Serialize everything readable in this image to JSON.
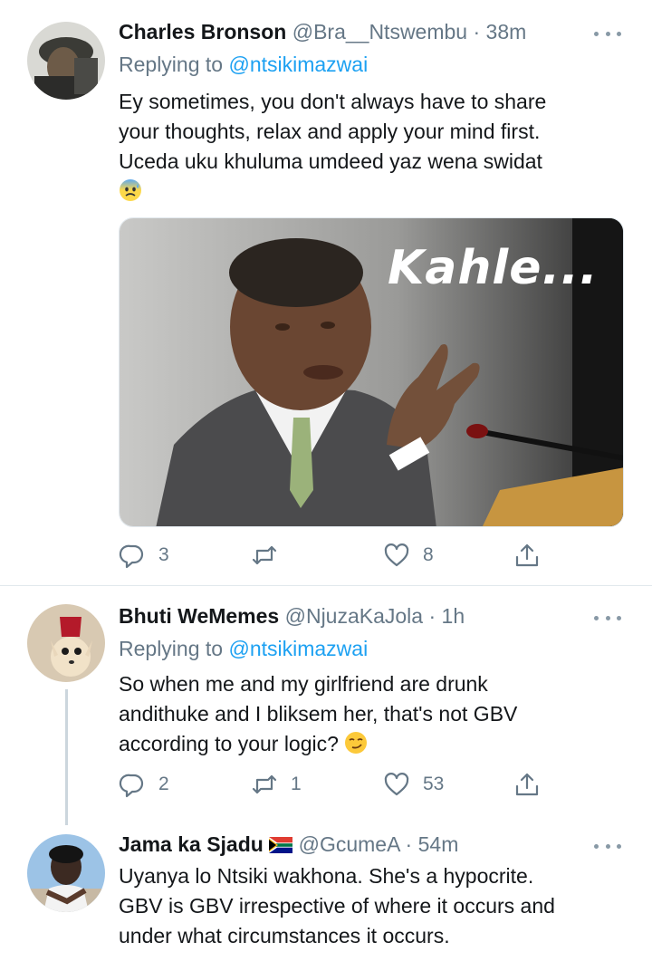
{
  "tweets": [
    {
      "name": "Charles Bronson",
      "handle": "@Bra__Ntswembu",
      "dot": "·",
      "time": "38m",
      "replying_prefix": "Replying to ",
      "replying_to": "@ntsikimazwai",
      "lines": [
        "Ey sometimes, you don't always have to share",
        "your thoughts, relax and apply your mind first.",
        "Uceda uku khuluma umdeed yaz wena swidat"
      ],
      "emoji": "anxious-face-with-sweat",
      "media_caption": "Kahle...",
      "replies": "3",
      "retweets": "",
      "likes": "8"
    },
    {
      "name": "Bhuti WeMemes",
      "handle": "@NjuzaKaJola",
      "dot": "·",
      "time": "1h",
      "replying_prefix": "Replying to ",
      "replying_to": "@ntsikimazwai",
      "lines": [
        "So when me and my girlfriend are drunk",
        "andithuke and I bliksem her, that's not GBV",
        "according to your logic?"
      ],
      "emoji": "smirking-face",
      "replies": "2",
      "retweets": "1",
      "likes": "53"
    },
    {
      "name": "Jama ka Sjadu",
      "flag": "south-africa-flag",
      "handle": "@GcumeA",
      "dot": "·",
      "time": "54m",
      "lines": [
        "Uyanya lo Ntsiki wakhona. She's a hypocrite.",
        "GBV is GBV irrespective of where it occurs and",
        "under what circumstances it occurs."
      ]
    }
  ],
  "colors": {
    "text": "#14171a",
    "muted": "#657786",
    "link": "#1da1f2",
    "icon": "#657786",
    "divider": "#e1e8ed"
  }
}
